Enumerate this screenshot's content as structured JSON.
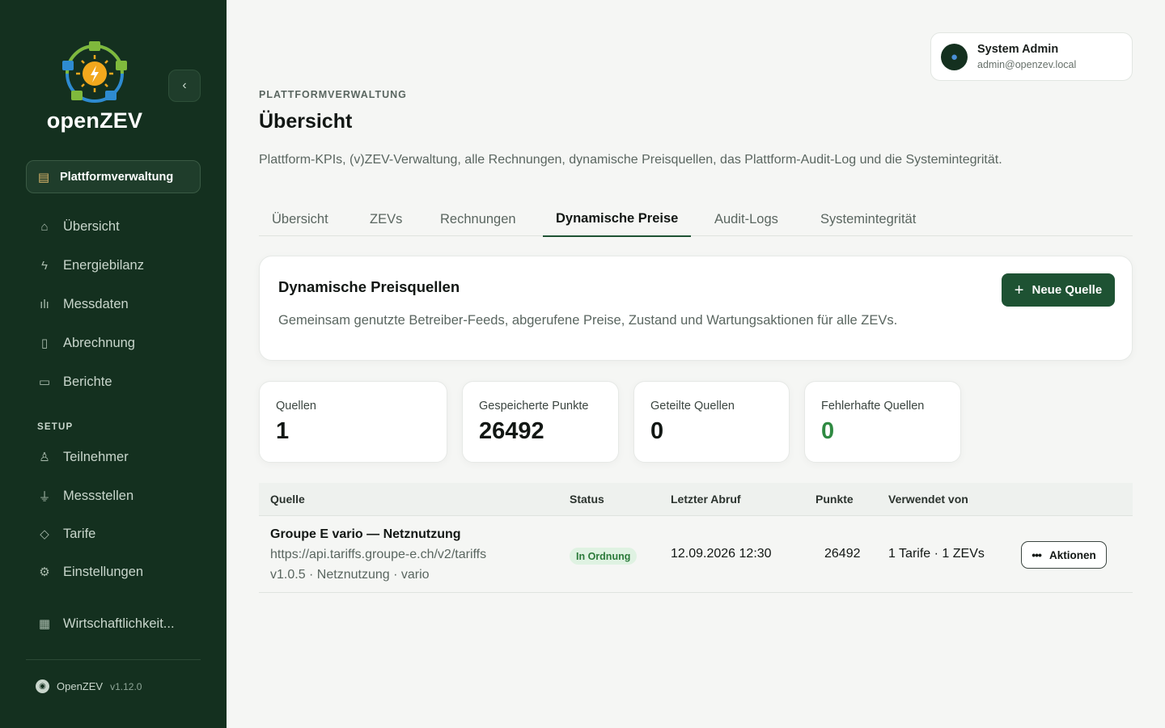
{
  "brand": {
    "name": "openZEV"
  },
  "sidebar": {
    "collapse_icon": "chevron-left-icon",
    "platform_pill": {
      "label": "Plattformverwaltung",
      "icon": "building-icon"
    },
    "items": [
      {
        "label": "Übersicht",
        "icon": "home-icon"
      },
      {
        "label": "Energiebilanz",
        "icon": "bolt-icon"
      },
      {
        "label": "Messdaten",
        "icon": "bar-chart-icon"
      },
      {
        "label": "Abrechnung",
        "icon": "receipt-icon"
      },
      {
        "label": "Berichte",
        "icon": "document-icon"
      }
    ],
    "setup_label": "SETUP",
    "setup_items": [
      {
        "label": "Teilnehmer",
        "icon": "user-icon"
      },
      {
        "label": "Messstellen",
        "icon": "plug-icon"
      },
      {
        "label": "Tarife",
        "icon": "tag-icon"
      },
      {
        "label": "Einstellungen",
        "icon": "gear-icon"
      }
    ],
    "extra_item": {
      "label": "Wirtschaftlichkeit...",
      "icon": "calculator-icon"
    },
    "footer": {
      "name": "OpenZEV",
      "version": "v1.12.0"
    }
  },
  "user": {
    "name": "System Admin",
    "email": "admin@openzev.local"
  },
  "header": {
    "eyebrow": "PLATTFORMVERWALTUNG",
    "title": "Übersicht",
    "description": "Plattform-KPIs, (v)ZEV-Verwaltung, alle Rechnungen, dynamische Preisquellen, das Plattform-Audit-Log und die Systemintegrität."
  },
  "tabs": [
    "Übersicht",
    "ZEVs",
    "Rechnungen",
    "Dynamische Preise",
    "Audit-Logs",
    "Systemintegrität"
  ],
  "active_tab": "Dynamische Preise",
  "section": {
    "title": "Dynamische Preisquellen",
    "description": "Gemeinsam genutzte Betreiber-Feeds, abgerufene Preise, Zustand und Wartungsaktionen für alle ZEVs.",
    "new_button": "Neue Quelle"
  },
  "kpis": [
    {
      "label": "Quellen",
      "value": "1"
    },
    {
      "label": "Gespeicherte Punkte",
      "value": "26492"
    },
    {
      "label": "Geteilte Quellen",
      "value": "0"
    },
    {
      "label": "Fehlerhafte Quellen",
      "value": "0"
    }
  ],
  "table": {
    "headers": [
      "Quelle",
      "Status",
      "Letzter Abruf",
      "Punkte",
      "Verwendet von"
    ],
    "rows": [
      {
        "name": "Groupe E vario — Netznutzung",
        "url": "https://api.tariffs.groupe-e.ch/v2/tariffs",
        "meta": "v1.0.5 · Netznutzung · vario",
        "status": "In Ordnung",
        "last_fetch": "12.09.2026 12:30",
        "points": "26492",
        "used_by": "1 Tarife · 1 ZEVs",
        "action": "Aktionen"
      }
    ]
  },
  "colors": {
    "sidebar_bg": "#14301f",
    "accent": "#1e5233",
    "success": "#2f8a42"
  }
}
